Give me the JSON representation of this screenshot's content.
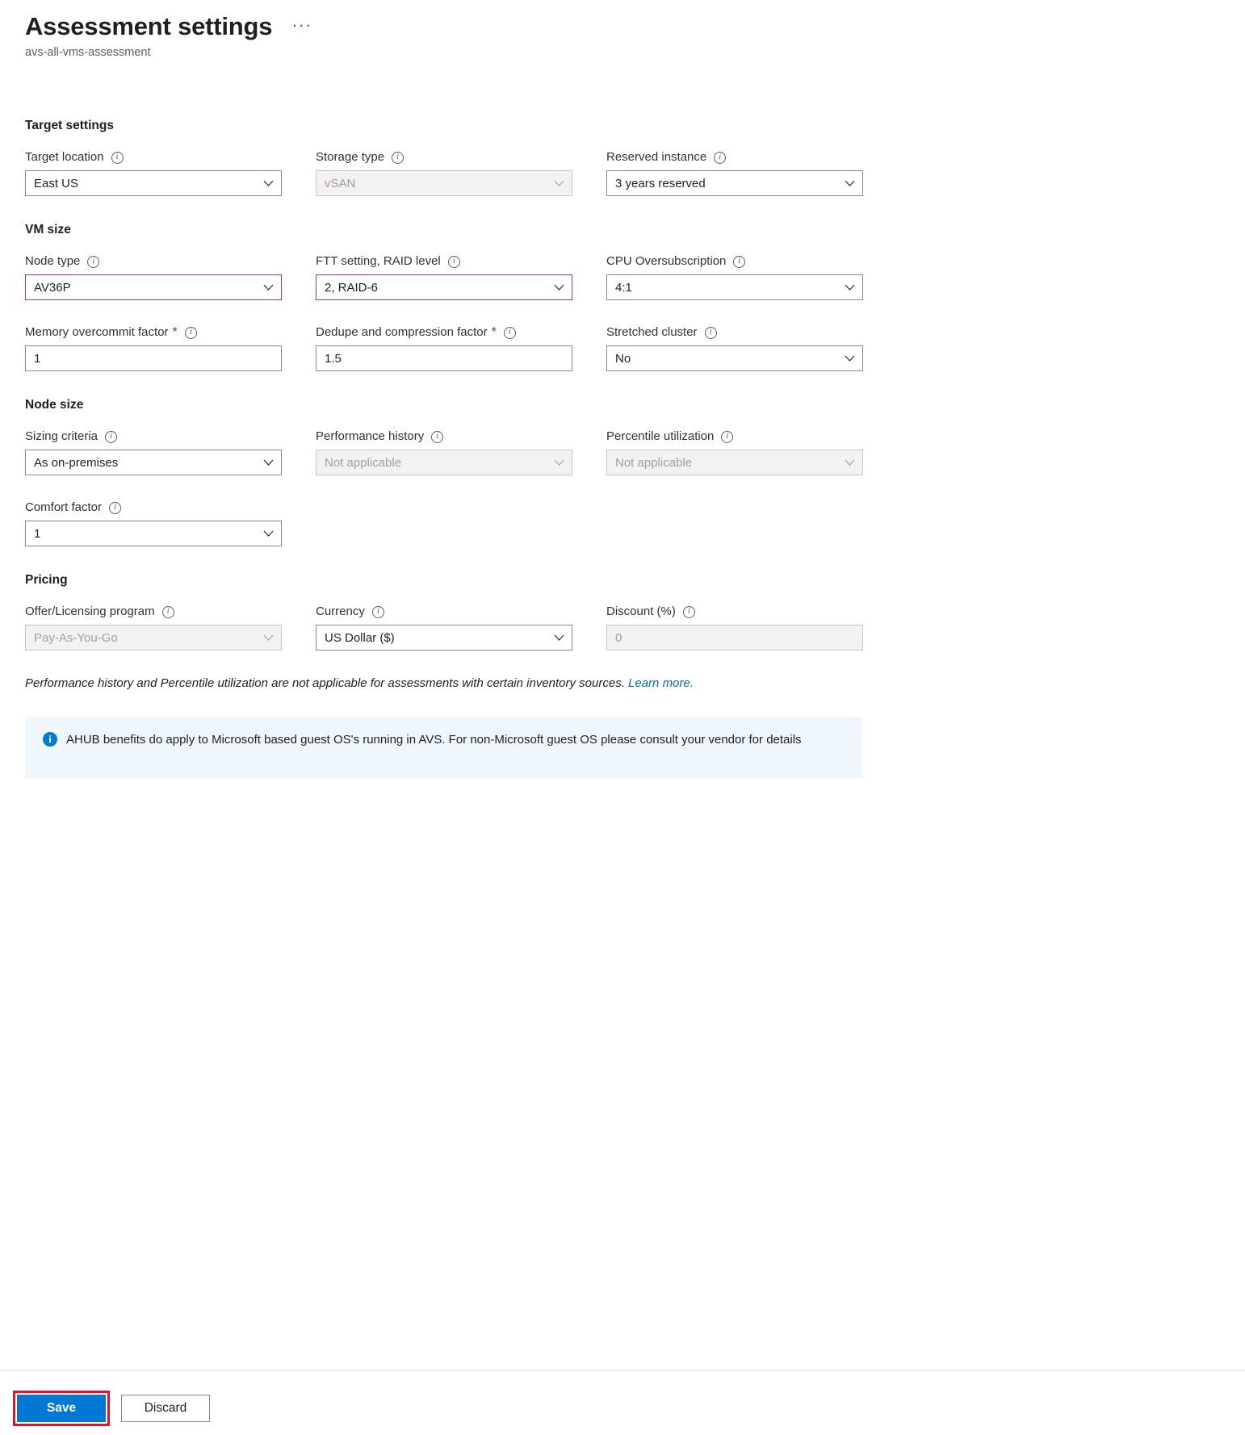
{
  "header": {
    "title": "Assessment settings",
    "subtitle": "avs-all-vms-assessment",
    "more_label": "···"
  },
  "icons": {
    "info": "i",
    "banner_info": "i",
    "chevron": "chevron-down-icon"
  },
  "colors": {
    "accent": "#0078d4",
    "highlight_border": "#8e3ea8",
    "focus_ring": "#e81123",
    "banner_bg": "#eff6fc",
    "required": "#a4262c",
    "link": "#0066cc"
  },
  "sections": [
    {
      "key": "target_settings",
      "title": "Target settings",
      "rows": [
        [
          {
            "name": "target-location",
            "label": "Target location",
            "info": true,
            "value": "East US",
            "type": "dropdown",
            "disabled": false,
            "highlight": false,
            "required": false
          },
          {
            "name": "storage-type",
            "label": "Storage type",
            "info": true,
            "value": "vSAN",
            "type": "dropdown",
            "disabled": true,
            "highlight": false,
            "required": false
          },
          {
            "name": "reserved-instance",
            "label": "Reserved instance",
            "info": true,
            "value": "3 years reserved",
            "type": "dropdown",
            "disabled": false,
            "highlight": false,
            "required": false
          }
        ]
      ]
    },
    {
      "key": "vm_size",
      "title": "VM size",
      "rows": [
        [
          {
            "name": "node-type",
            "label": "Node type",
            "info": true,
            "value": "AV36P",
            "type": "dropdown",
            "disabled": false,
            "highlight": true,
            "required": false
          },
          {
            "name": "ftt-setting-raid-level",
            "label": "FTT setting, RAID level",
            "info": true,
            "value": "2, RAID-6",
            "type": "dropdown",
            "disabled": false,
            "highlight": true,
            "required": false
          },
          {
            "name": "cpu-oversubscription",
            "label": "CPU Oversubscription",
            "info": true,
            "value": "4:1",
            "type": "dropdown",
            "disabled": false,
            "highlight": false,
            "required": false
          }
        ],
        [
          {
            "name": "memory-overcommit-factor",
            "label": "Memory overcommit factor",
            "info": true,
            "value": "1",
            "type": "textbox",
            "disabled": false,
            "highlight": false,
            "required": true
          },
          {
            "name": "dedupe-and-compression-factor",
            "label": "Dedupe and compression factor",
            "info": true,
            "value": "1.5",
            "type": "textbox",
            "disabled": false,
            "highlight": false,
            "required": true
          },
          {
            "name": "stretched-cluster",
            "label": "Stretched cluster",
            "info": true,
            "value": "No",
            "type": "dropdown",
            "disabled": false,
            "highlight": false,
            "required": false
          }
        ]
      ]
    },
    {
      "key": "node_size",
      "title": "Node size",
      "rows": [
        [
          {
            "name": "sizing-criteria",
            "label": "Sizing criteria",
            "info": true,
            "value": "As on-premises",
            "type": "dropdown",
            "disabled": false,
            "highlight": false,
            "required": false
          },
          {
            "name": "performance-history",
            "label": "Performance history",
            "info": true,
            "value": "Not applicable",
            "type": "dropdown",
            "disabled": true,
            "highlight": false,
            "required": false
          },
          {
            "name": "percentile-utilization",
            "label": "Percentile utilization",
            "info": true,
            "value": "Not applicable",
            "type": "dropdown",
            "disabled": true,
            "highlight": false,
            "required": false
          }
        ],
        [
          {
            "name": "comfort-factor",
            "label": "Comfort factor",
            "info": true,
            "value": "1",
            "type": "dropdown",
            "disabled": false,
            "highlight": false,
            "required": false
          }
        ]
      ]
    },
    {
      "key": "pricing",
      "title": "Pricing",
      "rows": [
        [
          {
            "name": "offer-licensing-program",
            "label": "Offer/Licensing program",
            "info": true,
            "value": "Pay-As-You-Go",
            "type": "dropdown",
            "disabled": true,
            "highlight": false,
            "required": false
          },
          {
            "name": "currency",
            "label": "Currency",
            "info": true,
            "value": "US Dollar ($)",
            "type": "dropdown",
            "disabled": false,
            "highlight": false,
            "required": false
          },
          {
            "name": "discount-percent",
            "label": "Discount (%)",
            "info": true,
            "value": "0",
            "type": "textbox",
            "disabled": true,
            "highlight": false,
            "required": false
          }
        ]
      ]
    }
  ],
  "note": {
    "text": "Performance history and Percentile utilization are not applicable for assessments with certain inventory sources.",
    "link_text": "Learn more."
  },
  "banner": {
    "text": "AHUB benefits do apply to Microsoft based guest OS's running in AVS. For non-Microsoft guest OS please consult your vendor for details"
  },
  "footer": {
    "save_label": "Save",
    "discard_label": "Discard"
  }
}
